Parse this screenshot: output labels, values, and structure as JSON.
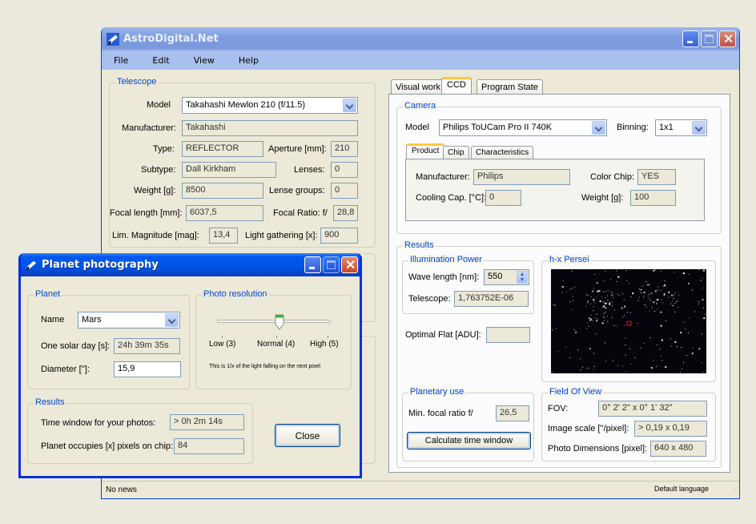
{
  "main_window": {
    "title": "AstroDigital.Net",
    "menu": [
      "File",
      "Edit",
      "View",
      "Help"
    ],
    "telescope": {
      "group_label": "Telescope",
      "model_label": "Model",
      "model_value": "Takahashi Mewlon 210 (f/11.5)",
      "manufacturer_label": "Manufacturer:",
      "manufacturer_value": "Takahashi",
      "type_label": "Type:",
      "type_value": "REFLECTOR",
      "aperture_label": "Aperture [mm]:",
      "aperture_value": "210",
      "subtype_label": "Subtype:",
      "subtype_value": "Dall Kirkham",
      "lenses_label": "Lenses:",
      "lenses_value": "0",
      "weight_label": "Weight [g]:",
      "weight_value": "8500",
      "lense_groups_label": "Lense groups:",
      "lense_groups_value": "0",
      "focal_length_label": "Focal length [mm]:",
      "focal_length_value": "6037,5",
      "focal_ratio_label": "Focal Ratio:  f/",
      "focal_ratio_value": "28,8",
      "lim_mag_label": "Lim. Magnitude [mag]:",
      "lim_mag_value": "13,4",
      "light_gathering_label": "Light gathering [x]:",
      "light_gathering_value": "900"
    },
    "tabs": [
      "Visual work",
      "CCD",
      "Program State"
    ],
    "active_tab": "CCD",
    "camera": {
      "group_label": "Camera",
      "model_label": "Model",
      "model_value": "Philips ToUCam Pro II 740K",
      "binning_label": "Binning:",
      "binning_value": "1x1",
      "subtabs": [
        "Product",
        "Chip",
        "Characteristics"
      ],
      "active_subtab": "Product",
      "manufacturer_label": "Manufacturer:",
      "manufacturer_value": "Philips",
      "color_chip_label": "Color Chip:",
      "color_chip_value": "YES",
      "cooling_label": "Cooling Cap. [°C]:",
      "cooling_value": "0",
      "weight_label": "Weight [g]:",
      "weight_value": "100"
    },
    "results": {
      "group_label": "Results",
      "illumination": {
        "group_label": "Illumination Power",
        "wave_length_label": "Wave length [nm]:",
        "wave_length_value": "550",
        "telescope_label": "Telescope:",
        "telescope_value": "1,763752E-06"
      },
      "optimal_flat_label": "Optimal Flat [ADU]:",
      "optimal_flat_value": "",
      "image_group_label": "h-x Persei",
      "planetary": {
        "group_label": "Planetary use",
        "min_focal_label": "Min. focal ratio f/",
        "min_focal_value": "26,5",
        "calc_button": "Calculate time window"
      },
      "fov": {
        "group_label": "Field Of View",
        "fov_label": "FOV:",
        "fov_value": "0° 2' 2\"  x 0° 1' 32\"",
        "scale_label": "Image scale [''/pixel]:",
        "scale_value": "> 0,19 x 0,19",
        "dims_label": "Photo Dimensions [pixel]:",
        "dims_value": "640 x 480"
      }
    },
    "status": {
      "left": "No news",
      "right": "Default language"
    }
  },
  "dialog": {
    "title": "Planet photography",
    "planet": {
      "group_label": "Planet",
      "name_label": "Name",
      "name_value": "Mars",
      "solar_day_label": "One solar day [s]:",
      "solar_day_value": "24h 39m 35s",
      "diameter_label": "Diameter ['']:",
      "diameter_value": "15,9"
    },
    "resolution": {
      "group_label": "Photo resolution",
      "ticks": [
        "Low (3)",
        "Normal (4)",
        "High (5)"
      ],
      "selected_index": 1,
      "note": "This is 1/x of the light falling on the next pixel"
    },
    "results": {
      "group_label": "Results",
      "time_window_label": "Time window for your photos:",
      "time_window_value": "> 0h 2m 14s",
      "pixels_label": "Planet occupies [x] pixels on chip:",
      "pixels_value": "84"
    },
    "close_button": "Close"
  }
}
